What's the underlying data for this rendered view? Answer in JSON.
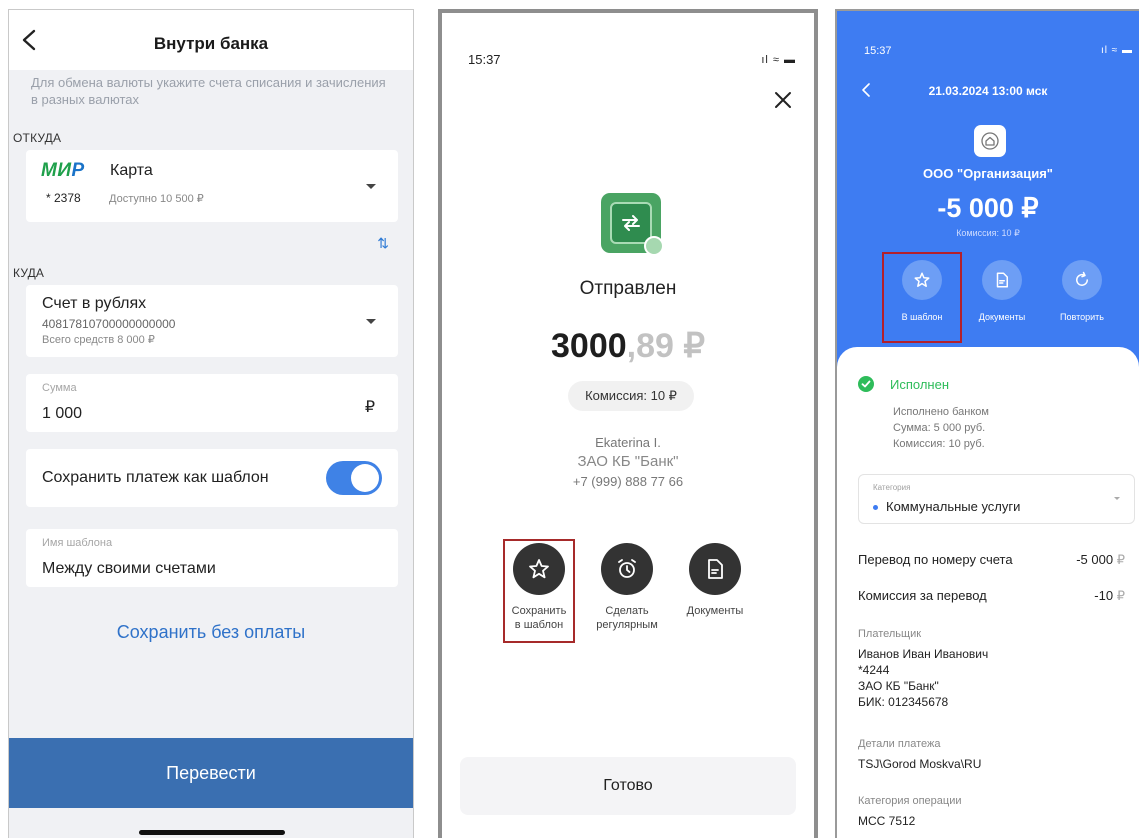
{
  "screen1": {
    "title": "Внутри банка",
    "hint": "Для обмена валюты укажите счета списания и зачисления в разных валютах",
    "from_label": "ОТКУДА",
    "card_brand": "МИР",
    "card_name": "Карта",
    "card_mask": "* 2378",
    "card_available": "Доступно 10 500 ₽",
    "swap_icon": "⇅",
    "to_label": "КУДА",
    "account_name": "Счет в рублях",
    "account_number": "40817810700000000000",
    "account_balance": "Всего средств 8 000 ₽",
    "amount_label": "Сумма",
    "amount_value": "1 000",
    "currency_symbol": "₽",
    "save_template_label": "Сохранить платеж как шаблон",
    "save_template_on": true,
    "template_name_label": "Имя шаблона",
    "template_name_value": "Между своими счетами",
    "save_without_payment": "Сохранить без оплаты",
    "transfer_button": "Перевести"
  },
  "screen2": {
    "time": "15:37",
    "status_icons": "ıl ≈ ▬",
    "status": "Отправлен",
    "amount_int": "3000",
    "amount_frac": ",89 ₽",
    "fee": "Комиссия: 10 ₽",
    "recipient_name": "Ekaterina I.",
    "recipient_bank": "ЗАО КБ \"Банк\"",
    "recipient_phone": "+7 (999) 888 77 66",
    "actions": [
      {
        "label_1": "Сохранить",
        "label_2": "в шаблон",
        "icon": "star-icon"
      },
      {
        "label_1": "Сделать",
        "label_2": "регулярным",
        "icon": "alarm-clock-icon"
      },
      {
        "label_1": "Документы",
        "label_2": "",
        "icon": "document-icon"
      }
    ],
    "done_button": "Готово"
  },
  "screen3": {
    "time": "15:37",
    "status_icons": "ıl ≈ ▬",
    "date": "21.03.2024 13:00 мск",
    "org": "ООО \"Организация\"",
    "amount": "-5 000 ₽",
    "fee": "Комиссия: 10 ₽",
    "actions": [
      {
        "label": "В шаблон",
        "icon": "star-icon"
      },
      {
        "label": "Документы",
        "icon": "document-icon"
      },
      {
        "label": "Повторить",
        "icon": "repeat-icon"
      }
    ],
    "executed": "Исполнен",
    "executed_by": "Исполнено банком",
    "sum_line": "Сумма: 5 000 руб.",
    "fee_line": "Комиссия: 10 руб.",
    "category_label": "Категория",
    "category_value": "Коммунальные услуги",
    "row1_label": "Перевод по номеру счета",
    "row1_value": "-5 000",
    "row2_label": "Комиссия за перевод",
    "row2_value": "-10",
    "ruble": "₽",
    "payer_label": "Плательщик",
    "payer_name": "Иванов Иван Иванович",
    "payer_card": "*4244",
    "payer_bank": "ЗАО КБ \"Банк\"",
    "payer_bik": "БИК: 012345678",
    "details_label": "Детали платежа",
    "details_value": "TSJ\\Gorod Moskva\\RU",
    "op_category_label": "Категория операции",
    "op_category_value": "МСС 7512"
  }
}
